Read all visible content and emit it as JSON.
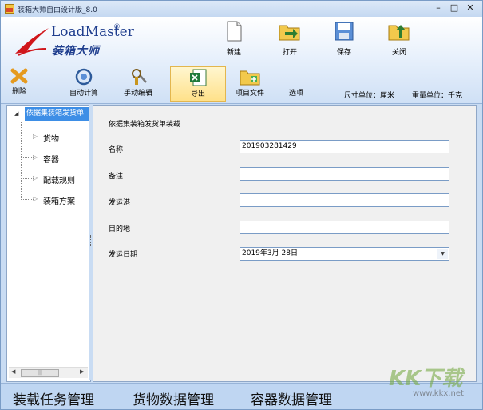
{
  "window": {
    "title": "装箱大师自由设计版_8.0",
    "min": "–",
    "max": "□",
    "close": "✕"
  },
  "logo": {
    "brand_en": "LoadMaster",
    "registered": "®",
    "brand_cn": "装箱大师"
  },
  "main_buttons": [
    {
      "label": "新建",
      "icon": "new-document-icon"
    },
    {
      "label": "打开",
      "icon": "open-folder-icon"
    },
    {
      "label": "保存",
      "icon": "save-disk-icon"
    },
    {
      "label": "关闭",
      "icon": "close-folder-icon"
    }
  ],
  "toolbar": [
    {
      "label": "删除",
      "icon": "delete-x-icon"
    },
    {
      "label": "自动计算",
      "icon": "auto-calc-icon"
    },
    {
      "label": "手动编辑",
      "icon": "manual-edit-icon"
    },
    {
      "label": "导出",
      "icon": "excel-export-icon",
      "selected": true
    },
    {
      "label": "项目文件",
      "icon": "project-file-icon"
    },
    {
      "label": "选项"
    }
  ],
  "units": {
    "size": "尺寸单位：厘米",
    "weight": "重量单位：千克"
  },
  "tree": {
    "root": "依据集装箱发货单",
    "items": [
      "货物",
      "容器",
      "配载规则",
      "装箱方案"
    ]
  },
  "form": {
    "title": "依据集装箱发货单装载",
    "fields": [
      {
        "label": "名称",
        "value": "201903281429"
      },
      {
        "label": "备注",
        "value": ""
      },
      {
        "label": "发运港",
        "value": ""
      },
      {
        "label": "目的地",
        "value": ""
      },
      {
        "label": "发运日期",
        "value": "2019年3月 28日"
      }
    ]
  },
  "bottom_nav": [
    "装载任务管理",
    "货物数据管理",
    "容器数据管理"
  ],
  "watermark": {
    "logo": "KK下载",
    "url": "www.kkx.net"
  },
  "colors": {
    "accent": "#3d8ee6",
    "brand": "#1f3e8e",
    "ribbon_selected": "#ffe18a",
    "window_bg": "#c9dcf3"
  }
}
